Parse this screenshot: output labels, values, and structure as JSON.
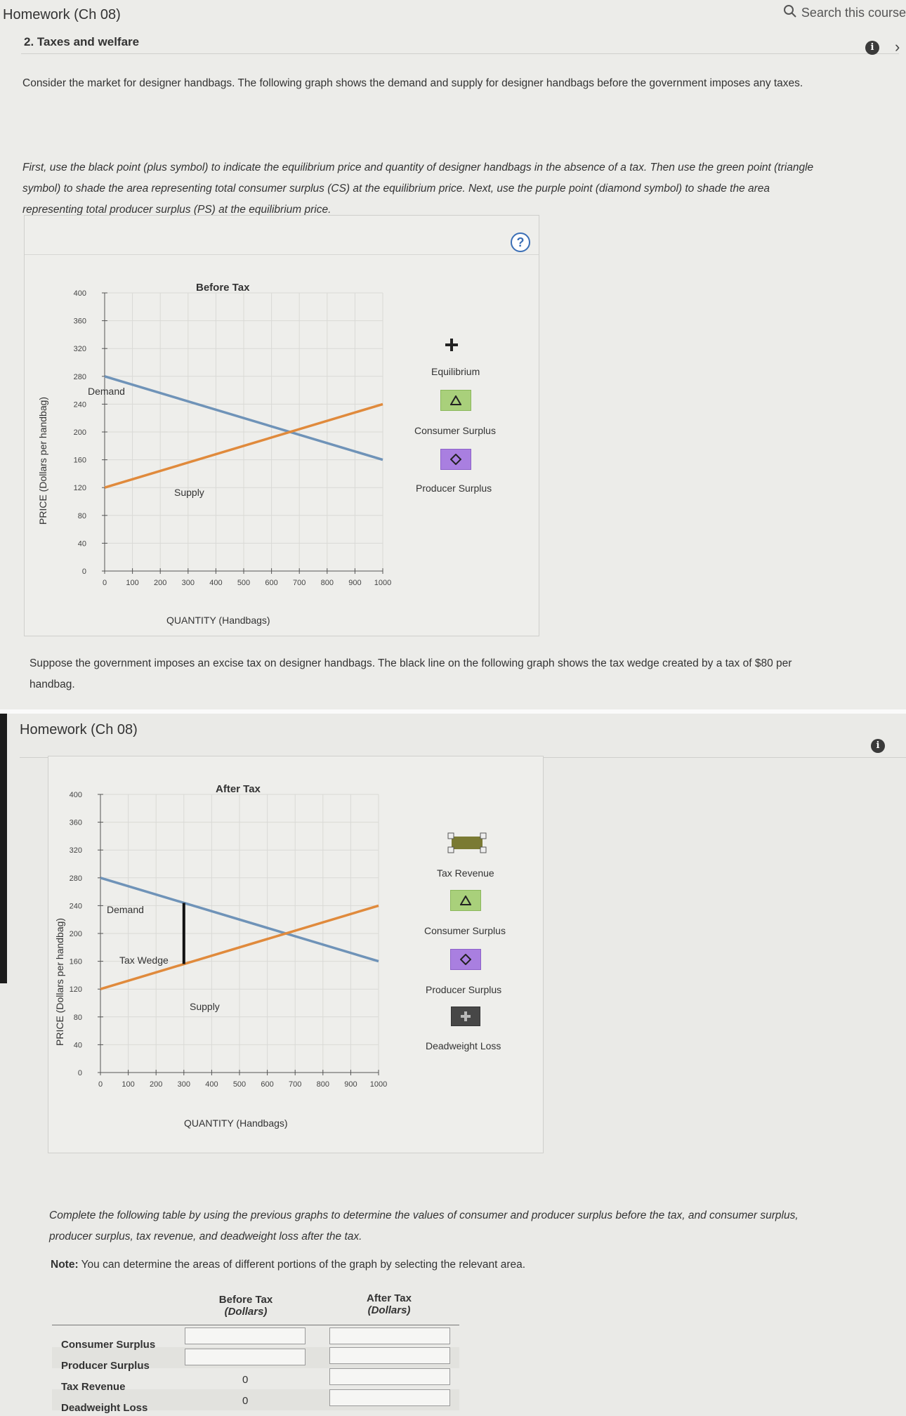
{
  "header": {
    "course_title": "Homework (Ch 08)",
    "search_placeholder": "Search this course",
    "question_title": "2. Taxes and welfare"
  },
  "intro": {
    "p1": "Consider the market for designer handbags. The following graph shows the demand and supply for designer handbags before the government imposes any taxes.",
    "p2": "First, use the black point (plus symbol) to indicate the equilibrium price and quantity of designer handbags in the absence of a tax. Then use the green point (triangle symbol) to shade the area representing total consumer surplus (CS) at the equilibrium price. Next, use the purple point (diamond symbol) to shade the area representing total producer surplus (PS) at the equilibrium price."
  },
  "graph1": {
    "help_label": "?",
    "legend": {
      "equilibrium": "Equilibrium",
      "consumer_surplus": "Consumer Surplus",
      "producer_surplus": "Producer Surplus"
    }
  },
  "tax_text": "Suppose the government imposes an excise tax on designer handbags. The black line on the following graph shows the tax wedge created by a tax of $80 per handbag.",
  "panel2_header": {
    "course_title": "Homework (Ch 08)"
  },
  "graph2": {
    "legend": {
      "tax_revenue": "Tax Revenue",
      "consumer_surplus": "Consumer Surplus",
      "producer_surplus": "Producer Surplus",
      "deadweight_loss": "Deadweight Loss"
    },
    "tax_wedge_label": "Tax Wedge"
  },
  "chart_data": [
    {
      "type": "line",
      "title": "Before Tax",
      "xlabel": "QUANTITY (Handbags)",
      "ylabel": "PRICE (Dollars per handbag)",
      "xlim": [
        0,
        1000
      ],
      "ylim": [
        0,
        400
      ],
      "x_ticks": [
        0,
        100,
        200,
        300,
        400,
        500,
        600,
        700,
        800,
        900,
        1000
      ],
      "y_ticks": [
        0,
        40,
        80,
        120,
        160,
        200,
        240,
        280,
        320,
        360,
        400
      ],
      "grid": true,
      "series": [
        {
          "name": "Demand",
          "color": "#6f93b8",
          "x": [
            0,
            1000
          ],
          "y": [
            280,
            160
          ]
        },
        {
          "name": "Supply",
          "color": "#e08a3c",
          "x": [
            0,
            1000
          ],
          "y": [
            120,
            240
          ]
        }
      ]
    },
    {
      "type": "line",
      "title": "After Tax",
      "xlabel": "QUANTITY (Handbags)",
      "ylabel": "PRICE (Dollars per handbag)",
      "xlim": [
        0,
        1000
      ],
      "ylim": [
        0,
        400
      ],
      "x_ticks": [
        0,
        100,
        200,
        300,
        400,
        500,
        600,
        700,
        800,
        900,
        1000
      ],
      "y_ticks": [
        0,
        40,
        80,
        120,
        160,
        200,
        240,
        280,
        320,
        360,
        400
      ],
      "grid": true,
      "series": [
        {
          "name": "Demand",
          "color": "#6f93b8",
          "x": [
            0,
            1000
          ],
          "y": [
            280,
            160
          ]
        },
        {
          "name": "Supply",
          "color": "#e08a3c",
          "x": [
            0,
            1000
          ],
          "y": [
            120,
            240
          ]
        }
      ],
      "tax_wedge": {
        "x": 300,
        "y": [
          156,
          244
        ],
        "color": "#111111"
      }
    }
  ],
  "table": {
    "instructions": "Complete the following table by using the previous graphs to determine the values of consumer and producer surplus before the tax, and consumer surplus, producer surplus, tax revenue, and deadweight loss after the tax.",
    "note_label": "Note:",
    "note_text": "You can determine the areas of different portions of the graph by selecting the relevant area.",
    "col_before": "Before Tax",
    "col_before_unit": "(Dollars)",
    "col_after": "After Tax",
    "col_after_unit": "(Dollars)",
    "rows": [
      {
        "label": "Consumer Surplus",
        "before": "",
        "after": ""
      },
      {
        "label": "Producer Surplus",
        "before": "",
        "after": ""
      },
      {
        "label": "Tax Revenue",
        "before": "0",
        "after": ""
      },
      {
        "label": "Deadweight Loss",
        "before": "0",
        "after": ""
      }
    ]
  }
}
